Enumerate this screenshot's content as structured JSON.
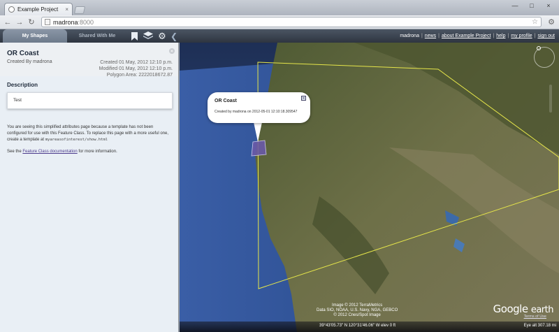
{
  "browser": {
    "tab_title": "Example Project",
    "tab_close": "×",
    "url_host": "madrona",
    "url_port": ":8000",
    "window_controls": [
      "—",
      "□",
      "×"
    ]
  },
  "header": {
    "tabs": [
      {
        "label": "My Shapes",
        "active": true
      },
      {
        "label": "Shared With Me",
        "active": false
      }
    ],
    "icons": [
      "bookmark-icon",
      "layers-icon",
      "gear-icon",
      "collapse-arrow-icon"
    ],
    "username": "madrona",
    "links": [
      "news",
      "about Example Project",
      "help",
      "my profile",
      "sign out"
    ]
  },
  "panel": {
    "title": "OR Coast",
    "created_by": "Created By madrona",
    "created": "Created 01 May, 2012 12:10 p.m.",
    "modified": "Modified 01 May, 2012 12:10 p.m.",
    "area": "Polygon Area: 2222018672.87",
    "description_heading": "Description",
    "description_text": "Test",
    "notice_part1": "You are seeing this simplified attributes page because a template has not been configured for use with this Feature Class. To replace this page with a more useful one, create a template at",
    "notice_code": "myareasofinterest/show.html",
    "notice2_prefix": "See the",
    "notice2_link": "Feature Class documentation",
    "notice2_suffix": "for more information."
  },
  "map": {
    "popup_title": "OR Coast",
    "popup_text": "Created by madrona on 2012-05-01 12:10:18.309547",
    "attribution_line1": "Image © 2012 TerraMetrics",
    "attribution_line2": "Data SIO, NOAA, U.S. Navy, NGA, GEBCO",
    "attribution_line3": "© 2012 Cnes/Spot Image",
    "logo_google": "Google",
    "logo_earth": "earth",
    "terms": "Terms of Use",
    "coordinates": "39°43'05.73\" N  120°31'46.06\" W  elev    0 ft",
    "eye_alt": "Eye alt   307.18 mi",
    "colors": {
      "ocean": "#2a4a8a",
      "land": "#5a6440",
      "outline": "#e6e64a",
      "polygon": "#6a5aa8"
    }
  }
}
